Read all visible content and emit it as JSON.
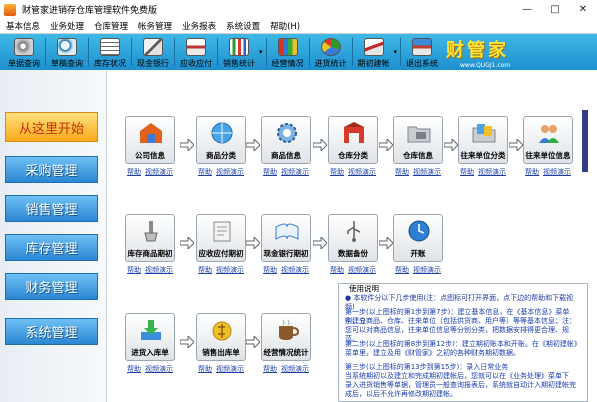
{
  "window": {
    "title": "财管家进销存仓库管理软件免费版",
    "controls": [
      "—",
      "□",
      "✕"
    ]
  },
  "menu": [
    "基本信息",
    "业务处理",
    "仓库管理",
    "帐务管理",
    "业务报表",
    "系统设置",
    "帮助(H)"
  ],
  "toolbar": {
    "items": [
      {
        "label": "单据查询",
        "icon": "magnifier-disk-icon"
      },
      {
        "label": "草稿查询",
        "icon": "magnifier-icon"
      },
      {
        "label": "库存状况",
        "icon": "stock-icon"
      },
      {
        "label": "现金银行",
        "icon": "cash-icon"
      },
      {
        "label": "应收应付",
        "icon": "receivable-icon"
      },
      {
        "label": "销售统计",
        "icon": "bar-chart-icon"
      },
      {
        "label": "经营情况",
        "icon": "books-icon"
      },
      {
        "label": "进货统计",
        "icon": "pie-chart-icon"
      },
      {
        "label": "期初建帐",
        "icon": "ledger-icon"
      },
      {
        "label": "退出系统",
        "icon": "exit-icon"
      }
    ],
    "logo_text": "财管家",
    "logo_sub": "www.QUGJ1.com"
  },
  "nav": {
    "start_label": "从这里开始",
    "items": [
      "采购管理",
      "销售管理",
      "库存管理",
      "财务管理",
      "系统管理"
    ]
  },
  "tiles": {
    "row1": [
      {
        "name": "公司信息",
        "icon": "company-icon"
      },
      {
        "name": "商品分类",
        "icon": "globe-icon"
      },
      {
        "name": "商品信息",
        "icon": "gear-icon"
      },
      {
        "name": "仓库分类",
        "icon": "warehouse-icon"
      },
      {
        "name": "仓库信息",
        "icon": "folder-icon"
      },
      {
        "name": "往来单位分类",
        "icon": "folder-docs-icon"
      },
      {
        "name": "往来单位信息",
        "icon": "users-icon"
      }
    ],
    "row2": [
      {
        "name": "库存商品期初",
        "icon": "brush-icon"
      },
      {
        "name": "应收应付期初",
        "icon": "clipboard-icon"
      },
      {
        "name": "现金银行期初",
        "icon": "book-icon"
      },
      {
        "name": "数据备份",
        "icon": "usb-icon"
      },
      {
        "name": "开账",
        "icon": "clock-icon"
      }
    ],
    "row3": [
      {
        "name": "进货入库单",
        "icon": "download-icon"
      },
      {
        "name": "销售出库单",
        "icon": "sales-icon"
      },
      {
        "name": "经营情况统计",
        "icon": "coffee-icon"
      }
    ],
    "link_help": "帮助",
    "link_video": "视频演示"
  },
  "usage": {
    "title": "使用说明",
    "lines": [
      "● 本软件分以下几步使用(注：点图标可打开界面，点下边的帮助和下载视频)",
      "第一步(以上图标的第1步到第7步)：建立基本信息，在《基本信息》菜单中，分",
      "别建立商品、仓库、往来单位（包括供货商、用户等）等等基本信息；注：",
      "您可以对商品信息，往来单位信息等分别分类，把数据安排得更合理、规范。",
      "第二步(以上图标的第8步到第12步)：建立期初账本和开账。在《期初建帐》",
      "菜单里，建立及用《财管家》之初的各种财务期初数据。",
      "第三步(以上图标的第13步到第15步)：录入日常业务",
      "当系统期初以及建立和完成期初建帐后，您就可以在《业务处理》菜单下",
      "录入进货销售等单据，管理员一般查询报表后，系统就自动计入期初建帐完",
      "成后，以后不允许再修改期初建帐。"
    ]
  }
}
